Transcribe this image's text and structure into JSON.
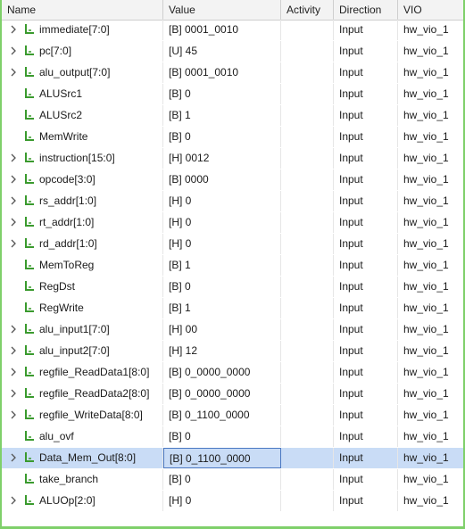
{
  "columns": {
    "name": "Name",
    "value": "Value",
    "activity": "Activity",
    "direction": "Direction",
    "vio": "VIO"
  },
  "colors": {
    "signal_icon": "#3a9a2e",
    "selection": "#c9dcf6",
    "frame_accent": "#7fd06a"
  },
  "icons": {
    "expand": "chevron-right-icon",
    "signal": "signal-probe-icon"
  },
  "rows": [
    {
      "name": "immediate[7:0]",
      "value": "[B] 0001_0010",
      "activity": "",
      "direction": "Input",
      "vio": "hw_vio_1",
      "expandable": true,
      "selected": false
    },
    {
      "name": "pc[7:0]",
      "value": "[U] 45",
      "activity": "",
      "direction": "Input",
      "vio": "hw_vio_1",
      "expandable": true,
      "selected": false
    },
    {
      "name": "alu_output[7:0]",
      "value": "[B] 0001_0010",
      "activity": "",
      "direction": "Input",
      "vio": "hw_vio_1",
      "expandable": true,
      "selected": false
    },
    {
      "name": "ALUSrc1",
      "value": "[B] 0",
      "activity": "",
      "direction": "Input",
      "vio": "hw_vio_1",
      "expandable": false,
      "selected": false
    },
    {
      "name": "ALUSrc2",
      "value": "[B] 1",
      "activity": "",
      "direction": "Input",
      "vio": "hw_vio_1",
      "expandable": false,
      "selected": false
    },
    {
      "name": "MemWrite",
      "value": "[B] 0",
      "activity": "",
      "direction": "Input",
      "vio": "hw_vio_1",
      "expandable": false,
      "selected": false
    },
    {
      "name": "instruction[15:0]",
      "value": "[H] 0012",
      "activity": "",
      "direction": "Input",
      "vio": "hw_vio_1",
      "expandable": true,
      "selected": false
    },
    {
      "name": "opcode[3:0]",
      "value": "[B] 0000",
      "activity": "",
      "direction": "Input",
      "vio": "hw_vio_1",
      "expandable": true,
      "selected": false
    },
    {
      "name": "rs_addr[1:0]",
      "value": "[H] 0",
      "activity": "",
      "direction": "Input",
      "vio": "hw_vio_1",
      "expandable": true,
      "selected": false
    },
    {
      "name": "rt_addr[1:0]",
      "value": "[H] 0",
      "activity": "",
      "direction": "Input",
      "vio": "hw_vio_1",
      "expandable": true,
      "selected": false
    },
    {
      "name": "rd_addr[1:0]",
      "value": "[H] 0",
      "activity": "",
      "direction": "Input",
      "vio": "hw_vio_1",
      "expandable": true,
      "selected": false
    },
    {
      "name": "MemToReg",
      "value": "[B] 1",
      "activity": "",
      "direction": "Input",
      "vio": "hw_vio_1",
      "expandable": false,
      "selected": false
    },
    {
      "name": "RegDst",
      "value": "[B] 0",
      "activity": "",
      "direction": "Input",
      "vio": "hw_vio_1",
      "expandable": false,
      "selected": false
    },
    {
      "name": "RegWrite",
      "value": "[B] 1",
      "activity": "",
      "direction": "Input",
      "vio": "hw_vio_1",
      "expandable": false,
      "selected": false
    },
    {
      "name": "alu_input1[7:0]",
      "value": "[H] 00",
      "activity": "",
      "direction": "Input",
      "vio": "hw_vio_1",
      "expandable": true,
      "selected": false
    },
    {
      "name": "alu_input2[7:0]",
      "value": "[H] 12",
      "activity": "",
      "direction": "Input",
      "vio": "hw_vio_1",
      "expandable": true,
      "selected": false
    },
    {
      "name": "regfile_ReadData1[8:0]",
      "value": "[B] 0_0000_0000",
      "activity": "",
      "direction": "Input",
      "vio": "hw_vio_1",
      "expandable": true,
      "selected": false
    },
    {
      "name": "regfile_ReadData2[8:0]",
      "value": "[B] 0_0000_0000",
      "activity": "",
      "direction": "Input",
      "vio": "hw_vio_1",
      "expandable": true,
      "selected": false
    },
    {
      "name": "regfile_WriteData[8:0]",
      "value": "[B] 0_1100_0000",
      "activity": "",
      "direction": "Input",
      "vio": "hw_vio_1",
      "expandable": true,
      "selected": false
    },
    {
      "name": "alu_ovf",
      "value": "[B] 0",
      "activity": "",
      "direction": "Input",
      "vio": "hw_vio_1",
      "expandable": false,
      "selected": false
    },
    {
      "name": "Data_Mem_Out[8:0]",
      "value": "[B] 0_1100_0000",
      "activity": "",
      "direction": "Input",
      "vio": "hw_vio_1",
      "expandable": true,
      "selected": true
    },
    {
      "name": "take_branch",
      "value": "[B] 0",
      "activity": "",
      "direction": "Input",
      "vio": "hw_vio_1",
      "expandable": false,
      "selected": false
    },
    {
      "name": "ALUOp[2:0]",
      "value": "[H] 0",
      "activity": "",
      "direction": "Input",
      "vio": "hw_vio_1",
      "expandable": true,
      "selected": false
    }
  ]
}
